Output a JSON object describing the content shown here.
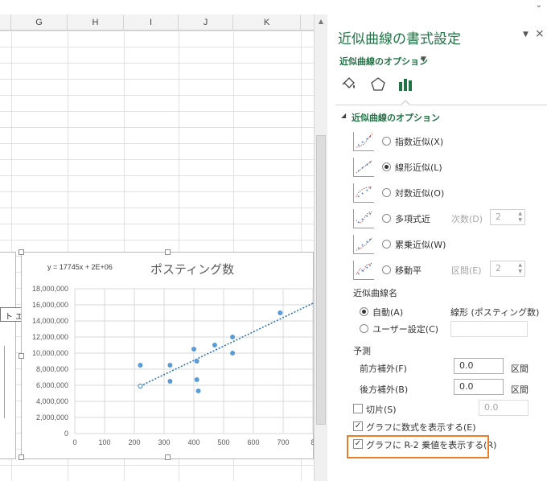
{
  "sheet": {
    "columns": [
      "G",
      "H",
      "I",
      "J",
      "K"
    ]
  },
  "chart": {
    "title": "ポスティング数",
    "equation": "y = 17745x + 2E+06",
    "trendline": {
      "slope": 17745,
      "intercept": 2000000
    },
    "tooltip": "ト エリア"
  },
  "chart_data": {
    "type": "scatter",
    "title": "ポスティング数",
    "xlabel": "",
    "ylabel": "",
    "xlim": [
      0,
      800
    ],
    "ylim": [
      0,
      18000000
    ],
    "x_ticks": [
      "0",
      "100",
      "200",
      "300",
      "400",
      "500",
      "600",
      "700",
      "8"
    ],
    "y_ticks": [
      "0",
      "2,000,000",
      "4,000,000",
      "6,000,000",
      "8,000,000",
      "10,000,000",
      "12,000,000",
      "14,000,000",
      "16,000,000",
      "18,000,000"
    ],
    "x_tick_values": [
      0,
      100,
      200,
      300,
      400,
      500,
      600,
      700,
      800
    ],
    "y_tick_values": [
      0,
      2000000,
      4000000,
      6000000,
      8000000,
      10000000,
      12000000,
      14000000,
      16000000,
      18000000
    ],
    "grid": true,
    "points": [
      {
        "x": 220,
        "y": 8500000
      },
      {
        "x": 320,
        "y": 8500000
      },
      {
        "x": 320,
        "y": 6500000
      },
      {
        "x": 400,
        "y": 10500000
      },
      {
        "x": 410,
        "y": 9000000
      },
      {
        "x": 410,
        "y": 6700000
      },
      {
        "x": 415,
        "y": 5300000
      },
      {
        "x": 470,
        "y": 11000000
      },
      {
        "x": 530,
        "y": 12000000
      },
      {
        "x": 530,
        "y": 10000000
      },
      {
        "x": 690,
        "y": 15000000
      }
    ],
    "colors": {
      "points": "#5b9bd5",
      "trendline": "#2e75b6"
    }
  },
  "pane": {
    "title": "近似曲線の書式設定",
    "options_link": "近似曲線のオプション",
    "section_header": "近似曲線のオプション",
    "trend_types": [
      {
        "label": "指数近似(X)",
        "selected": false
      },
      {
        "label": "線形近似(L)",
        "selected": true
      },
      {
        "label": "対数近似(O)",
        "selected": false
      },
      {
        "label": "多項式近",
        "selected": false,
        "extra_label": "次数(D)",
        "extra_value": "2"
      },
      {
        "label": "累乗近似(W)",
        "selected": false
      },
      {
        "label": "移動平",
        "selected": false,
        "extra_label": "区間(E)",
        "extra_value": "2"
      }
    ],
    "name_header": "近似曲線名",
    "auto_label": "自動(A)",
    "auto_value": "線形 (ポスティング数)",
    "custom_label": "ユーザー設定(C)",
    "forecast_header": "予測",
    "forward_label": "前方補外(F)",
    "forward_value": "0.0",
    "forward_unit": "区間",
    "backward_label": "後方補外(B)",
    "backward_value": "0.0",
    "backward_unit": "区間",
    "intercept_label": "切片(S)",
    "intercept_value": "0.0",
    "show_equation_label": "グラフに数式を表示する(E)",
    "show_equation_checked": true,
    "show_r2_label": "グラフに R-2 乗値を表示する(R)",
    "show_r2_checked": true
  },
  "colors": {
    "accent": "#217346",
    "highlight": "#e87d2a"
  }
}
